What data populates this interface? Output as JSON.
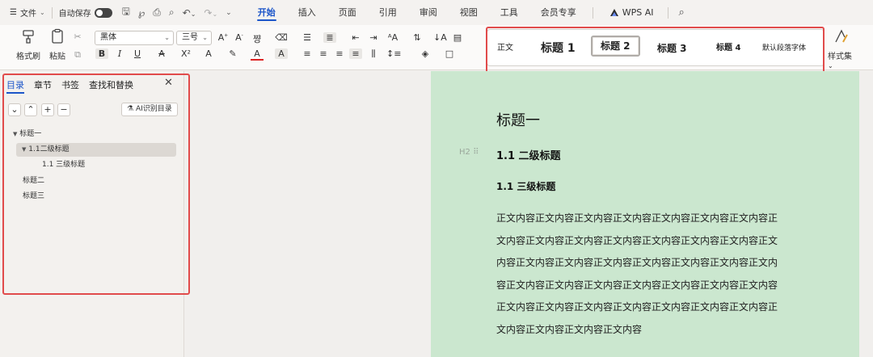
{
  "menubar": {
    "file_label": "文件",
    "autosave_label": "自动保存",
    "tabs": [
      "开始",
      "插入",
      "页面",
      "引用",
      "审阅",
      "视图",
      "工具",
      "会员专享"
    ],
    "wps_ai": "WPS AI"
  },
  "ribbon": {
    "format_painter": "格式刷",
    "paste": "粘贴",
    "font_name": "黑体",
    "font_size": "三号",
    "style_set": "样式集",
    "styles": [
      "正文",
      "标题 1",
      "标题 2",
      "标题 3",
      "标题 4",
      "默认段落字体"
    ]
  },
  "navpane": {
    "tabs": [
      "目录",
      "章节",
      "书签",
      "查找和替换"
    ],
    "ai_toc_button": "AI识别目录",
    "toc": [
      "标题一",
      "1.1二级标题",
      "1.1 三级标题",
      "标题二",
      "标题三"
    ]
  },
  "document": {
    "heading1": "标题一",
    "heading2": "1.1  二级标题",
    "heading3": "1.1 三级标题",
    "heading_marker": "H2",
    "body_lines": [
      "正文内容正文内容正文内容正文内容正文内容正文内容正文内容正",
      "文内容正文内容正文内容正文内容正文内容正文内容正文内容正文",
      "内容正文内容正文内容正文内容正文内容正文内容正文内容正文内",
      "容正文内容正文内容正文内容正文内容正文内容正文内容正文内容",
      "正文内容正文内容正文内容正文内容正文内容正文内容正文内容正",
      "文内容正文内容正文内容正文内容"
    ]
  },
  "colors": {
    "accent": "#1b55c9",
    "highlight_box": "#e14b4b",
    "page_background": "#cbe7cf"
  }
}
